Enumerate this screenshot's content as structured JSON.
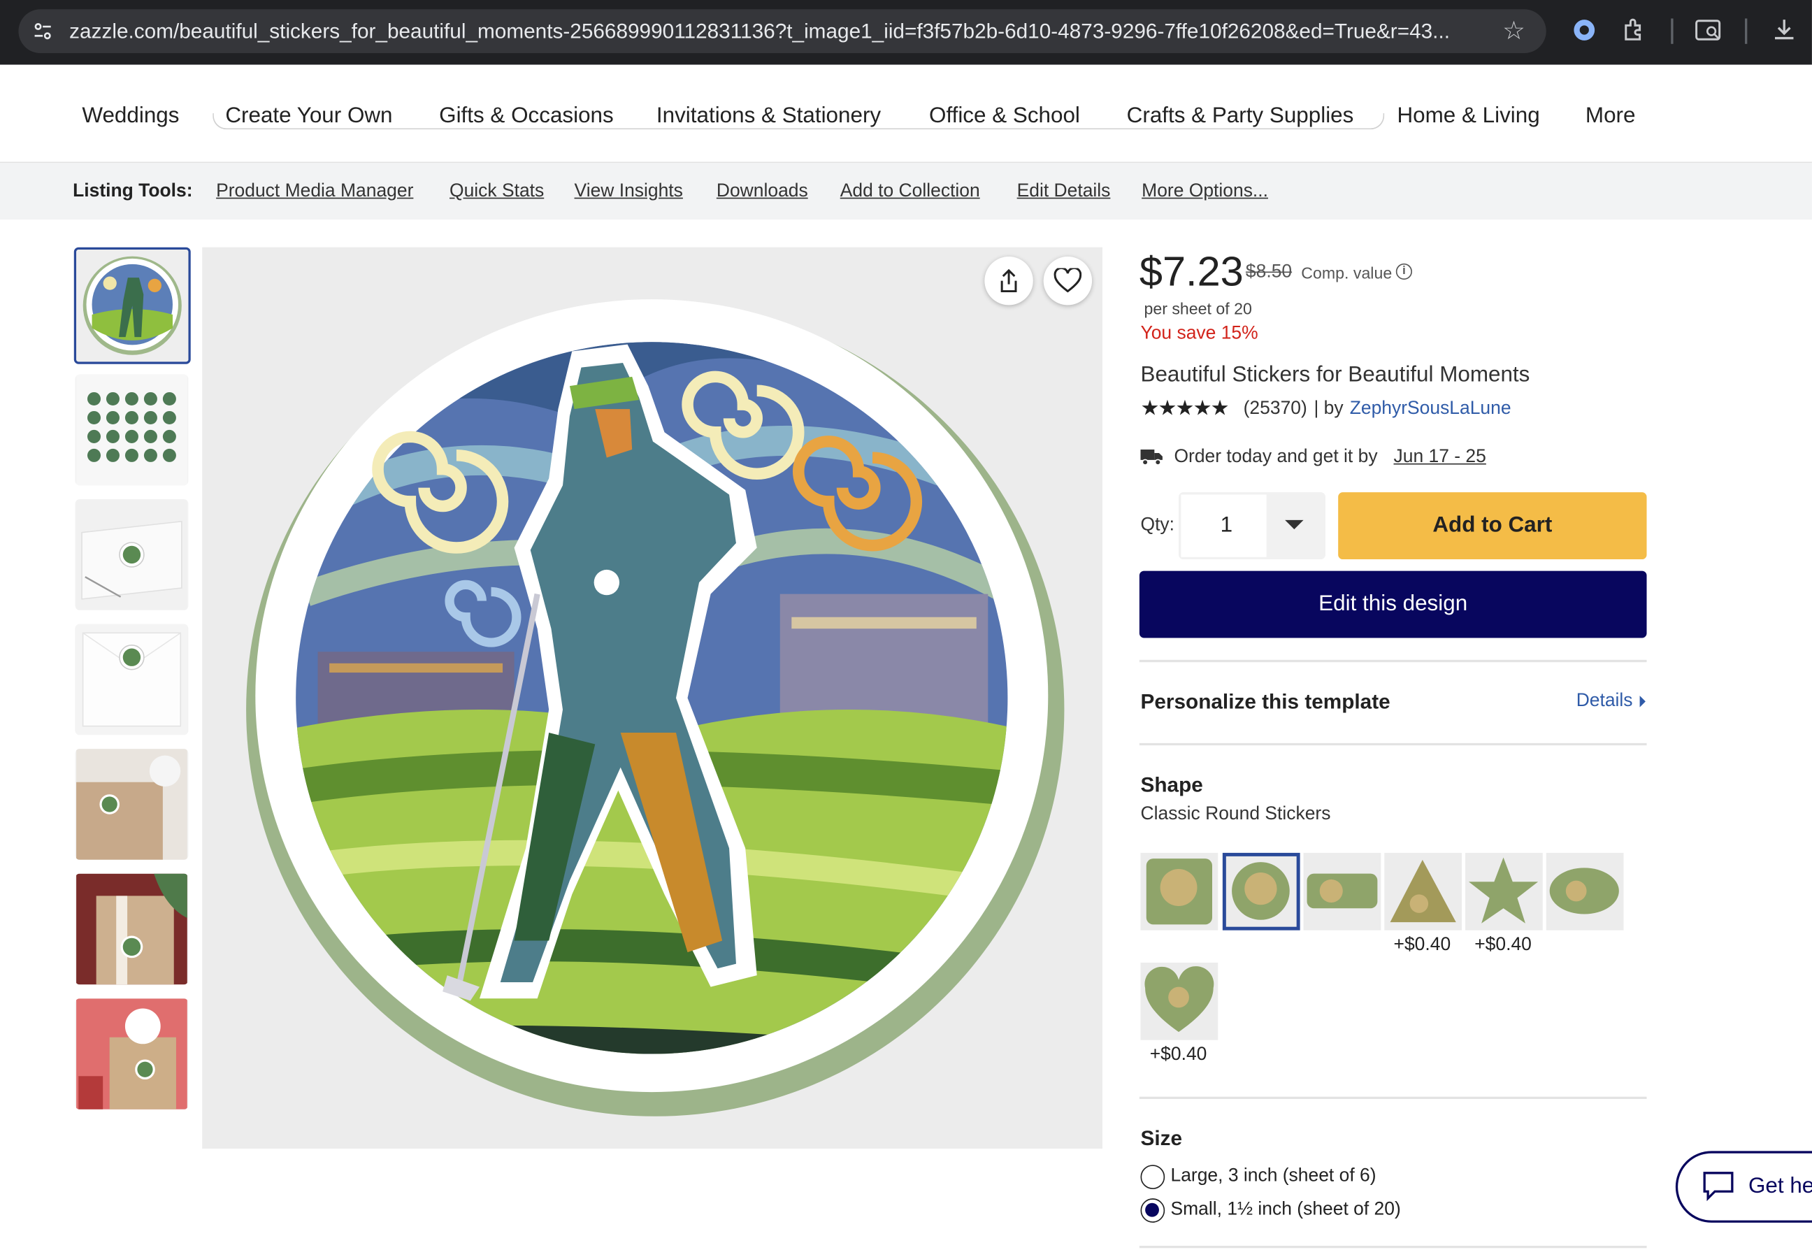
{
  "browser": {
    "url": "zazzle.com/beautiful_stickers_for_beautiful_moments-256689990112831136?t_image1_iid=f3f57b2b-6d10-4873-9296-7ffe10f26208&ed=True&r=43..."
  },
  "category_nav": [
    "Weddings",
    "Create Your Own",
    "Gifts & Occasions",
    "Invitations & Stationery",
    "Office & School",
    "Crafts & Party Supplies",
    "Home & Living",
    "More"
  ],
  "listing_tools": {
    "label": "Listing Tools:",
    "links": [
      "Product Media Manager",
      "Quick Stats",
      "View Insights",
      "Downloads",
      "Add to Collection",
      "Edit Details",
      "More Options..."
    ]
  },
  "product": {
    "price": "$7.23",
    "comp_price": "$8.50",
    "comp_label": "Comp. value",
    "per_sheet": "per sheet of 20",
    "savings": "You save 15%",
    "title": "Beautiful Stickers for Beautiful Moments",
    "stars": "★★★★★",
    "rating": 5,
    "review_count": "(25370)",
    "by_label": "| by",
    "designer": "ZephyrSousLaLune",
    "delivery_text": "Order today and get it by",
    "delivery_date": "Jun 17 - 25"
  },
  "purchase": {
    "qty_label": "Qty:",
    "qty_value": "1",
    "add_to_cart": "Add to Cart",
    "edit_design": "Edit this design"
  },
  "personalize": {
    "label": "Personalize this template",
    "details": "Details"
  },
  "shape": {
    "heading": "Shape",
    "selected": "Classic Round Stickers",
    "surcharges": [
      "+$0.40",
      "+$0.40",
      "+$0.40"
    ]
  },
  "size": {
    "heading": "Size",
    "options": [
      {
        "label": "Large, 3 inch (sheet of 6)",
        "checked": false
      },
      {
        "label": "Small, 1½ inch (sheet of 20)",
        "checked": true
      }
    ]
  },
  "help": {
    "label": "Get he"
  },
  "colors": {
    "cart": "#f4bc47",
    "edit": "#08065e",
    "link": "#2f5ba8",
    "savings": "#d2231a"
  }
}
